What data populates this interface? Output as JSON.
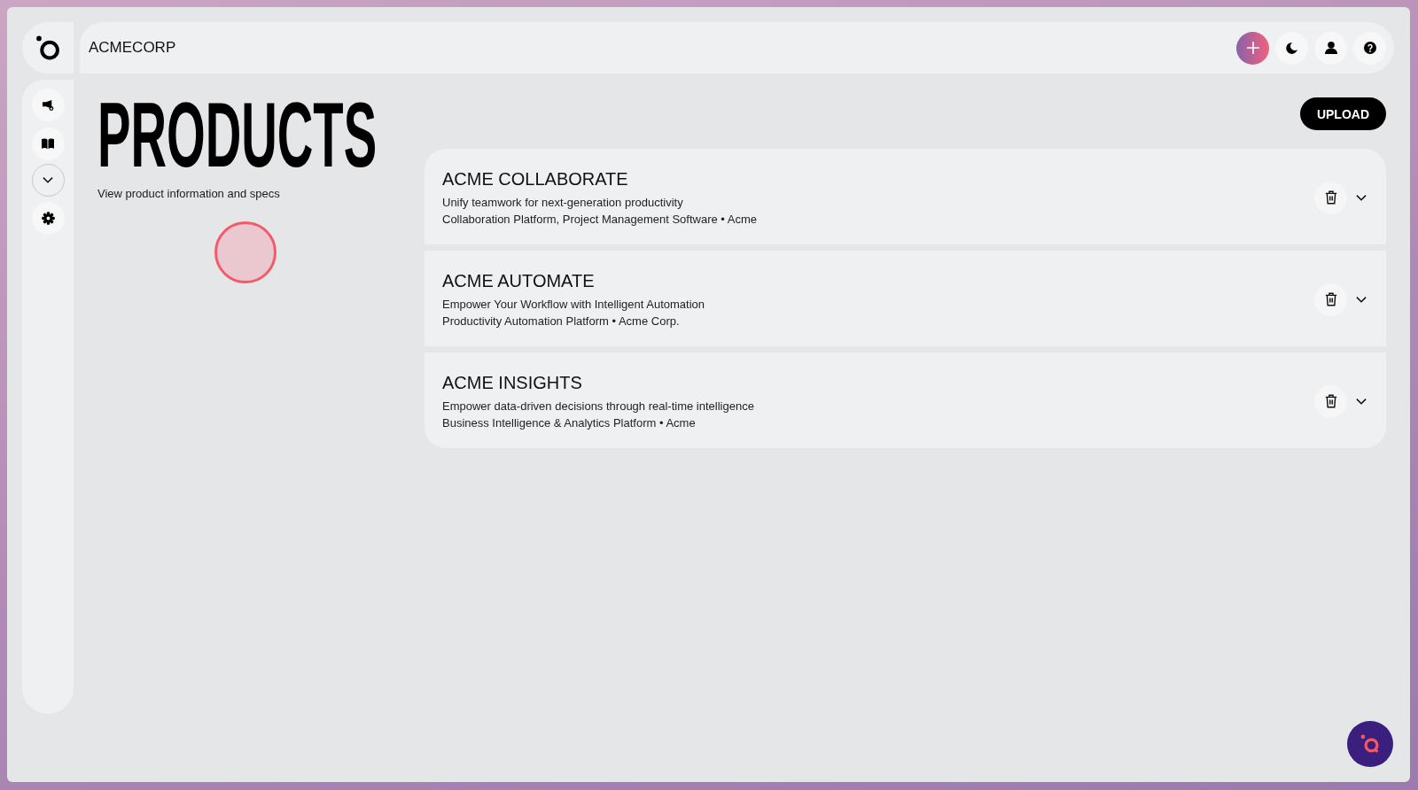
{
  "topbar": {
    "brand": "ACMECORP"
  },
  "page": {
    "title": "PRODUCTS",
    "subtitle": "View product information and specs",
    "upload_button": "UPLOAD"
  },
  "products": [
    {
      "name": "ACME COLLABORATE",
      "tagline": "Unify teamwork for next-generation productivity",
      "details": "Collaboration Platform, Project Management Software • Acme"
    },
    {
      "name": "ACME AUTOMATE",
      "tagline": "Empower Your Workflow with Intelligent Automation",
      "details": "Productivity Automation Platform • Acme Corp."
    },
    {
      "name": "ACME INSIGHTS",
      "tagline": "Empower data-driven decisions through real-time intelligence",
      "details": "Business Intelligence & Analytics Platform • Acme"
    }
  ]
}
